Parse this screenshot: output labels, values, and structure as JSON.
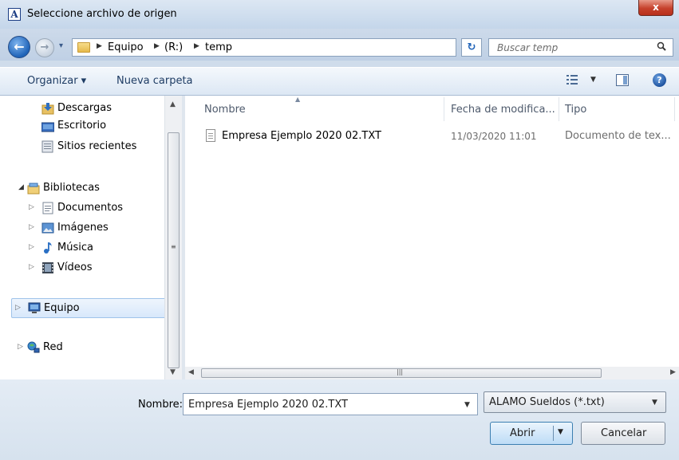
{
  "window": {
    "title": "Seleccione archivo de origen",
    "app_icon_letter": "A",
    "close_glyph": "x"
  },
  "nav": {
    "back_glyph": "←",
    "forward_glyph": "→",
    "breadcrumbs": [
      "Equipo",
      "(R:)",
      "temp"
    ],
    "search_placeholder": "Buscar temp"
  },
  "toolbar": {
    "organize_label": "Organizar ▾",
    "new_folder_label": "Nueva carpeta",
    "help_glyph": "?"
  },
  "sidebar": {
    "items": [
      {
        "label": "Descargas",
        "icon": "downloads-icon"
      },
      {
        "label": "Escritorio",
        "icon": "desktop-icon"
      },
      {
        "label": "Sitios recientes",
        "icon": "recent-places-icon"
      },
      {
        "label": "Bibliotecas",
        "icon": "libraries-icon"
      },
      {
        "label": "Documentos",
        "icon": "documents-icon"
      },
      {
        "label": "Imágenes",
        "icon": "pictures-icon"
      },
      {
        "label": "Música",
        "icon": "music-icon"
      },
      {
        "label": "Vídeos",
        "icon": "videos-icon"
      },
      {
        "label": "Equipo",
        "icon": "computer-icon",
        "selected": true
      },
      {
        "label": "Red",
        "icon": "network-icon"
      }
    ]
  },
  "file_list": {
    "columns": [
      "Nombre",
      "Fecha de modifica...",
      "Tipo"
    ],
    "rows": [
      {
        "name": "Empresa Ejemplo 2020 02.TXT",
        "date": "11/03/2020 11:01",
        "type": "Documento de tex..."
      }
    ]
  },
  "bottom": {
    "name_label": "Nombre:",
    "file_name_value": "Empresa Ejemplo 2020 02.TXT",
    "filter_value": "ALAMO Sueldos (*.txt)",
    "open_label": "Abrir",
    "cancel_label": "Cancelar"
  },
  "colors": {
    "accent": "#1f63b8",
    "selection": "#d8e8fb"
  }
}
